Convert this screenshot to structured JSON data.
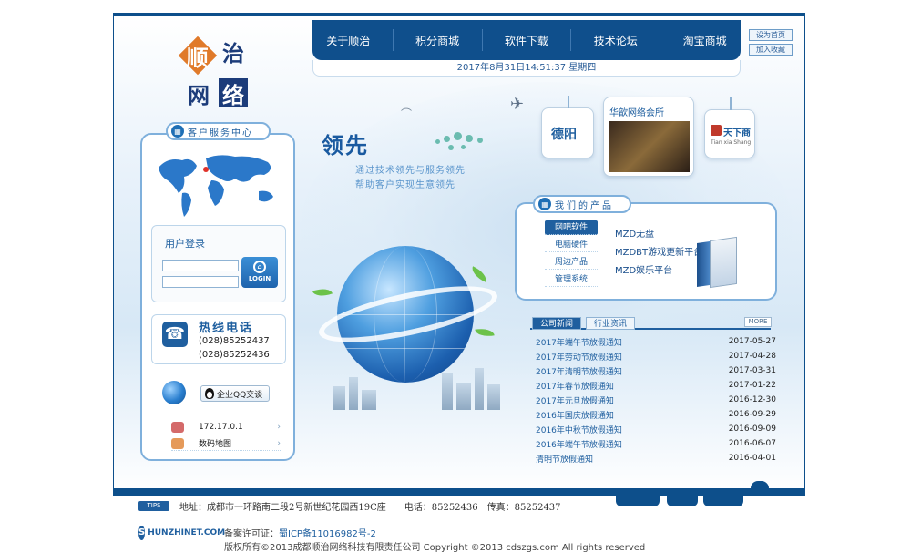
{
  "site": {
    "logo_chars": [
      "顺",
      "治",
      "网",
      "络"
    ]
  },
  "nav": {
    "items": [
      "关于顺治",
      "积分商城",
      "软件下载",
      "技术论坛",
      "淘宝商城"
    ],
    "datetime": "2017年8月31日14:51:37 星期四"
  },
  "quick_links": [
    "设为首页",
    "加入收藏"
  ],
  "service_center": {
    "title": "客户服务中心",
    "login_title": "用户登录",
    "login_button": "LOGIN",
    "hotline_title": "热线电话",
    "hotline_numbers": [
      "(028)85252437",
      "(028)85252436"
    ],
    "qq_button": "企业QQ交谈",
    "ip": "172.17.0.1",
    "map_link": "数码地图"
  },
  "hero": {
    "title": "领先",
    "subtitle_lines": [
      "通过技术领先与服务领先",
      "帮助客户实现生意领先"
    ]
  },
  "cards": {
    "card1": "德阳",
    "card2": "华歆网络会所",
    "card3_main": "天下商",
    "card3_sub": "Tian xia Shang"
  },
  "products": {
    "title": "我们的产品",
    "tabs": [
      "网吧软件",
      "电脑硬件",
      "周边产品",
      "管理系统"
    ],
    "items": [
      "MZD无盘",
      "MZDBT游戏更新平台",
      "MZD娱乐平台"
    ]
  },
  "news": {
    "tabs": [
      "公司新闻",
      "行业资讯"
    ],
    "more": "MORE",
    "rows": [
      {
        "title": "2017年端午节放假通知",
        "date": "2017-05-27"
      },
      {
        "title": "2017年劳动节放假通知",
        "date": "2017-04-28"
      },
      {
        "title": "2017年清明节放假通知",
        "date": "2017-03-31"
      },
      {
        "title": "2017年春节放假通知",
        "date": "2017-01-22"
      },
      {
        "title": "2017年元旦放假通知",
        "date": "2016-12-30"
      },
      {
        "title": "2016年国庆放假通知",
        "date": "2016-09-29"
      },
      {
        "title": "2016年中秋节放假通知",
        "date": "2016-09-09"
      },
      {
        "title": "2016年端午节放假通知",
        "date": "2016-06-07"
      },
      {
        "title": "清明节放假通知",
        "date": "2016-04-01"
      }
    ]
  },
  "footer": {
    "tips_label": "TIPS",
    "tips_text": "地址：成都市一环路南二段2号新世纪花园西19C座　　电话：85252436　传真：85252437",
    "logo_text": "HUNZHINET.COM",
    "logo_letter": "S",
    "icp_label": "备案许可证：",
    "icp_value": "蜀ICP备11016982号-2",
    "copyright": "版权所有©2013成都顺治网络科技有限责任公司 Copyright ©2013 cdszgs.com All rights reserved"
  },
  "colors": {
    "primary": "#0f4f8c",
    "accent_orange": "#e07a2a",
    "link_blue": "#1f5f9f"
  }
}
